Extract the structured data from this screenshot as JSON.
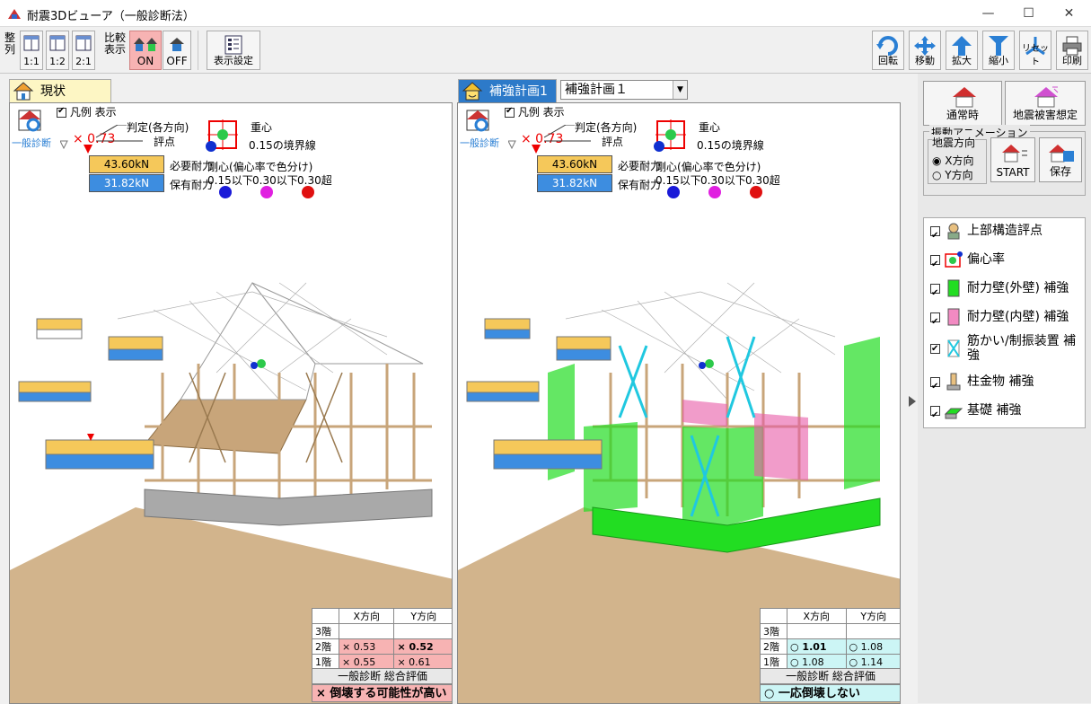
{
  "window": {
    "title": "耐震3Dビューア（一般診断法）",
    "minimize": "—",
    "maximize": "☐",
    "close": "✕"
  },
  "toolbar": {
    "arrange_label": "整列",
    "ratio_11": "1:1",
    "ratio_12": "1:2",
    "ratio_21": "2:1",
    "compare_label": "比較表示",
    "on_label": "ON",
    "off_label": "OFF",
    "display_settings": "表示設定",
    "rotate": "回転",
    "move": "移動",
    "zoom_in": "拡大",
    "zoom_out": "縮小",
    "reset": "リセット",
    "print": "印刷"
  },
  "left": {
    "tab": "現状",
    "diag_label": "一般診断",
    "legend_show": "凡例 表示",
    "judgment": "判定(各方向)",
    "score_label": "評点",
    "score": "× 0.73",
    "required_value": "43.60kN",
    "required_label": "必要耐力",
    "held_value": "31.82kN",
    "held_label": "保有耐力",
    "gravity": "重心",
    "boundary": "0.15の境界線",
    "rigidity": "剛心(偏心率で色分け)",
    "r1": "0.15以下",
    "r2": "0.30以下",
    "r3": "0.30超",
    "table": {
      "h1": "X方向",
      "h2": "Y方向",
      "rows": [
        {
          "floor": "3階",
          "x": "",
          "y": ""
        },
        {
          "floor": "2階",
          "x": "× 0.53",
          "y": "× 0.52"
        },
        {
          "floor": "1階",
          "x": "× 0.55",
          "y": "× 0.61"
        }
      ]
    },
    "overall_label": "一般診断 総合評価",
    "overall": "× 倒壊する可能性が高い"
  },
  "right": {
    "tab": "補強計画1",
    "plan_select": "補強計画１",
    "diag_label": "一般診断",
    "legend_show": "凡例 表示",
    "judgment": "判定(各方向)",
    "score_label": "評点",
    "score": "× 0.73",
    "required_value": "43.60kN",
    "required_label": "必要耐力",
    "held_value": "31.82kN",
    "held_label": "保有耐力",
    "gravity": "重心",
    "boundary": "0.15の境界線",
    "rigidity": "剛心(偏心率で色分け)",
    "r1": "0.15以下",
    "r2": "0.30以下",
    "r3": "0.30超",
    "table": {
      "h1": "X方向",
      "h2": "Y方向",
      "rows": [
        {
          "floor": "3階",
          "x": "",
          "y": ""
        },
        {
          "floor": "2階",
          "x": "○ 1.01",
          "y": "○ 1.08"
        },
        {
          "floor": "1階",
          "x": "○ 1.08",
          "y": "○ 1.14"
        }
      ]
    },
    "overall_label": "一般診断 総合評価",
    "overall": "○ 一応倒壊しない"
  },
  "sidebar": {
    "normal": "通常時",
    "quake": "地震被害想定",
    "anim_group": "振動アニメーション",
    "direction_group": "地震方向",
    "x_dir": "X方向",
    "y_dir": "Y方向",
    "start": "START",
    "save": "保存",
    "options": [
      "上部構造評点",
      "偏心率",
      "耐力壁(外壁) 補強",
      "耐力壁(内壁) 補強",
      "筋かい/制振装置 補強",
      "柱金物 補強",
      "基礎 補強"
    ]
  },
  "colors": {
    "pink_bad": "#f7b3b3",
    "cyan_ok": "#ccf5f5",
    "required": "#f5c85a",
    "held": "#3d8de0",
    "green_wall": "#22dd22",
    "pink_wall": "#e85aa6"
  }
}
